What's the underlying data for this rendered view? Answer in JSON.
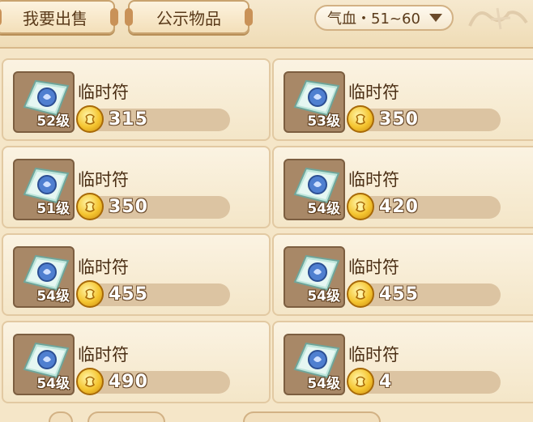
{
  "tabs": {
    "sell_label": "我要出售",
    "public_label": "公示物品"
  },
  "filter": {
    "label": "气血・51~60"
  },
  "items": [
    {
      "name": "临时符",
      "level": "52级",
      "price": "315"
    },
    {
      "name": "临时符",
      "level": "53级",
      "price": "350"
    },
    {
      "name": "临时符",
      "level": "51级",
      "price": "350"
    },
    {
      "name": "临时符",
      "level": "54级",
      "price": "420"
    },
    {
      "name": "临时符",
      "level": "54级",
      "price": "455"
    },
    {
      "name": "临时符",
      "level": "54级",
      "price": "455"
    },
    {
      "name": "临时符",
      "level": "54级",
      "price": "490"
    },
    {
      "name": "临时符",
      "level": "54级",
      "price": "4"
    }
  ],
  "icons": {
    "item": "talisman-icon",
    "currency": "gold-coin-icon",
    "dropdown": "chevron-down-icon"
  },
  "colors": {
    "background": "#f5e6c8",
    "card": "#fbf3e2",
    "price_bar": "#dcc4a2",
    "coin": "#f5c530",
    "text": "#4a2e14"
  }
}
